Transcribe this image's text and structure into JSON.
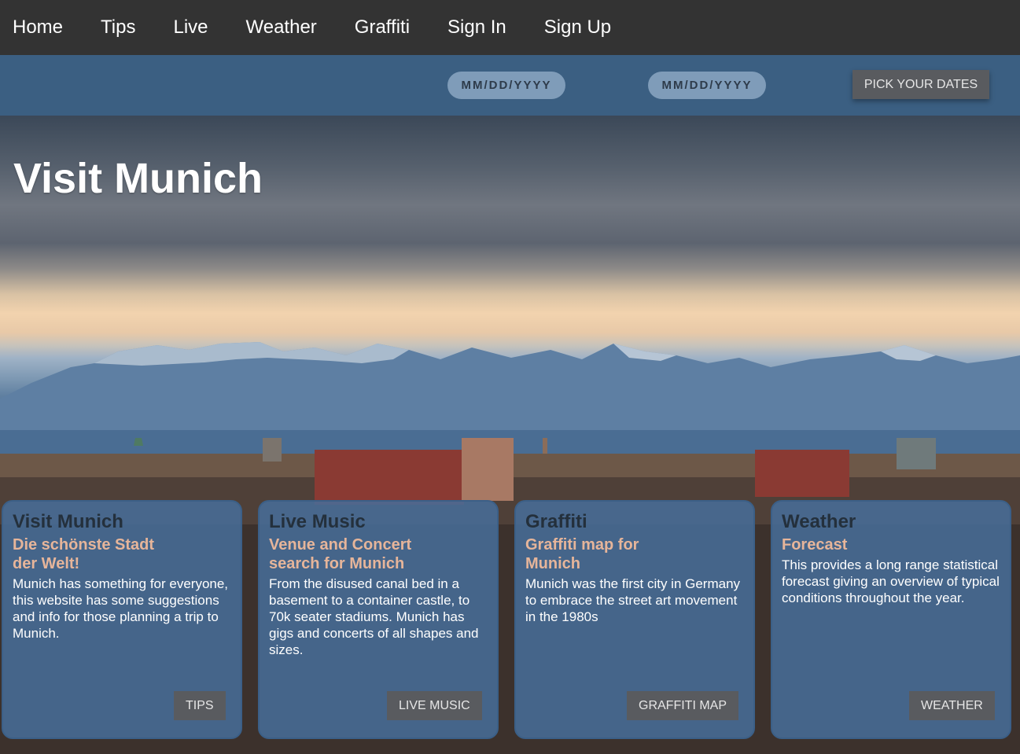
{
  "nav": {
    "items": [
      "Home",
      "Tips",
      "Live",
      "Weather",
      "Graffiti",
      "Sign In",
      "Sign Up"
    ]
  },
  "datebar": {
    "start_placeholder": "MM/DD/YYYY",
    "end_placeholder": "MM/DD/YYYY",
    "pick_label": "PICK YOUR DATES"
  },
  "hero": {
    "title": "Visit Munich"
  },
  "cards": [
    {
      "title": "Visit Munich",
      "subtitle": "Die schönste Stadt der Welt!",
      "text": "Munich has something for everyone, this website has some suggestions and info for those planning a trip to Munich.",
      "button": "TIPS"
    },
    {
      "title": "Live Music",
      "subtitle": "Venue and Concert search for Munich",
      "text": "From the disused canal bed in a basement to a container castle, to 70k seater stadiums. Munich has gigs and concerts of all shapes and sizes.",
      "button": "LIVE MUSIC"
    },
    {
      "title": "Graffiti",
      "subtitle": "Graffiti map for Munich",
      "text": "Munich was the first city in Germany to embrace the street art movement in the 1980s",
      "button": "GRAFFITI MAP"
    },
    {
      "title": "Weather",
      "subtitle": "Forecast",
      "text": "This provides a long range statistical forecast giving an overview of typical conditions throughout the year.",
      "button": "WEATHER"
    }
  ]
}
